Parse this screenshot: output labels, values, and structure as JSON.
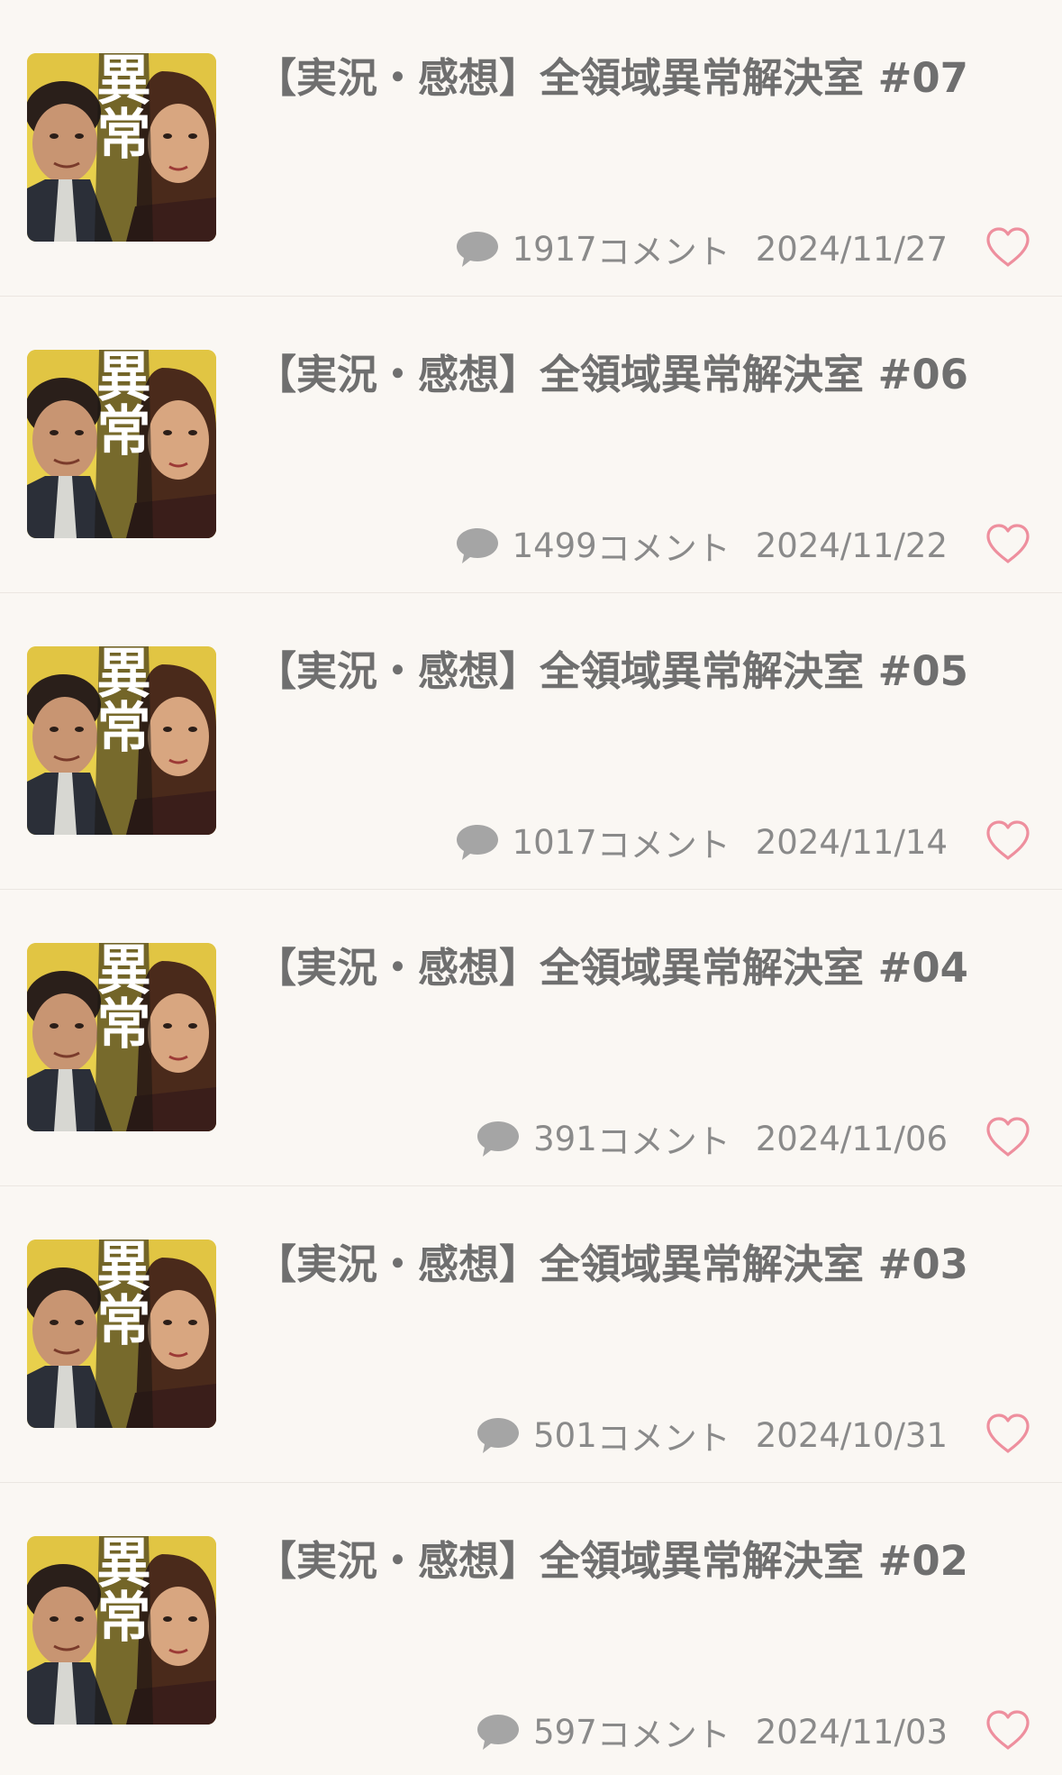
{
  "threads": [
    {
      "title": "【実況・感想】全領域異常解決室 #07",
      "comment_count": "1917",
      "comment_unit": "コメント",
      "date": "2024/11/27",
      "thumbnail_text": "異常"
    },
    {
      "title": "【実況・感想】全領域異常解決室 #06",
      "comment_count": "1499",
      "comment_unit": "コメント",
      "date": "2024/11/22",
      "thumbnail_text": "異常"
    },
    {
      "title": "【実況・感想】全領域異常解決室 #05",
      "comment_count": "1017",
      "comment_unit": "コメント",
      "date": "2024/11/14",
      "thumbnail_text": "異常"
    },
    {
      "title": "【実況・感想】全領域異常解決室 #04",
      "comment_count": "391",
      "comment_unit": "コメント",
      "date": "2024/11/06",
      "thumbnail_text": "異常"
    },
    {
      "title": "【実況・感想】全領域異常解決室 #03",
      "comment_count": "501",
      "comment_unit": "コメント",
      "date": "2024/10/31",
      "thumbnail_text": "異常"
    },
    {
      "title": "【実況・感想】全領域異常解決室 #02",
      "comment_count": "597",
      "comment_unit": "コメント",
      "date": "2024/11/03",
      "thumbnail_text": "異常"
    }
  ],
  "colors": {
    "background": "#faf7f3",
    "heart": "#ee8f9e",
    "comment_icon": "#a7a7a7",
    "thumbnail_yellow": "#e9d34a"
  },
  "icons": {
    "comment": "speech-bubble-icon",
    "favorite": "heart-outline-icon"
  }
}
